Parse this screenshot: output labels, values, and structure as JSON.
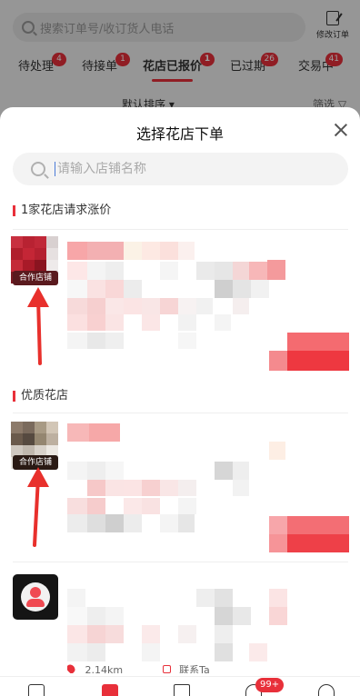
{
  "top": {
    "search_placeholder": "搜索订单号/收订货人电话",
    "edit_order_label": "修改订单"
  },
  "tabs": [
    {
      "label": "待处理",
      "badge": "4"
    },
    {
      "label": "待接单",
      "badge": "1"
    },
    {
      "label": "花店已报价",
      "badge": "1",
      "active": true
    },
    {
      "label": "已过期",
      "badge": "26"
    },
    {
      "label": "交易中",
      "badge": "41"
    }
  ],
  "sortbar": {
    "sort_label": "默认排序 ▾",
    "filter_label": "筛选 ▽"
  },
  "sheet": {
    "title": "选择花店下单",
    "search_placeholder": "请输入店铺名称",
    "section1_title": "1家花店请求涨价",
    "section2_title": "优质花店",
    "partner_tag": "合作店铺",
    "meta_distance": "2.14km",
    "meta_contact": "联系Ta"
  },
  "nav": {
    "message_badge": "99+"
  },
  "colors": {
    "accent": "#e8303a",
    "button_red": "#f03c44",
    "tag_dark": "#5a1a1e"
  }
}
